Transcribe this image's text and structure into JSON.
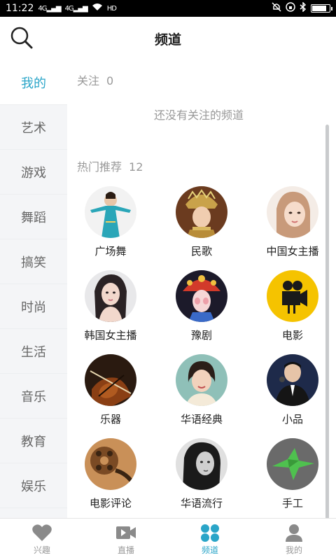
{
  "status_bar": {
    "time": "11:22",
    "network": "4G",
    "hd": "HD",
    "battery_level": 0.85
  },
  "header": {
    "title": "频道"
  },
  "sidebar": {
    "items": [
      {
        "label": "我的",
        "active": true
      },
      {
        "label": "艺术"
      },
      {
        "label": "游戏"
      },
      {
        "label": "舞蹈"
      },
      {
        "label": "搞笑"
      },
      {
        "label": "时尚"
      },
      {
        "label": "生活"
      },
      {
        "label": "音乐"
      },
      {
        "label": "教育"
      },
      {
        "label": "娱乐"
      }
    ]
  },
  "following": {
    "label": "关注",
    "count": "0",
    "empty_text": "还没有关注的频道"
  },
  "hot": {
    "label": "热门推荐",
    "count": "12",
    "channels": [
      {
        "label": "广场舞",
        "icon": "dancer-avatar"
      },
      {
        "label": "民歌",
        "icon": "folk-singer-avatar"
      },
      {
        "label": "中国女主播",
        "icon": "chinese-streamer-avatar"
      },
      {
        "label": "韩国女主播",
        "icon": "korean-streamer-avatar"
      },
      {
        "label": "豫剧",
        "icon": "opera-avatar"
      },
      {
        "label": "电影",
        "icon": "movie-camera-avatar"
      },
      {
        "label": "乐器",
        "icon": "violin-avatar"
      },
      {
        "label": "华语经典",
        "icon": "classic-singer-avatar"
      },
      {
        "label": "小品",
        "icon": "comedian-avatar"
      },
      {
        "label": "电影评论",
        "icon": "film-reel-avatar"
      },
      {
        "label": "华语流行",
        "icon": "pop-singer-avatar"
      },
      {
        "label": "手工",
        "icon": "origami-avatar"
      }
    ]
  },
  "bottom_nav": {
    "items": [
      {
        "label": "兴趣",
        "icon": "heart-icon"
      },
      {
        "label": "直播",
        "icon": "video-camera-icon"
      },
      {
        "label": "频道",
        "icon": "channel-grid-icon",
        "active": true
      },
      {
        "label": "我的",
        "icon": "person-icon"
      }
    ]
  },
  "colors": {
    "accent": "#2aa5c8",
    "muted_text": "#999999",
    "sidebar_bg": "#f4f5f7"
  }
}
